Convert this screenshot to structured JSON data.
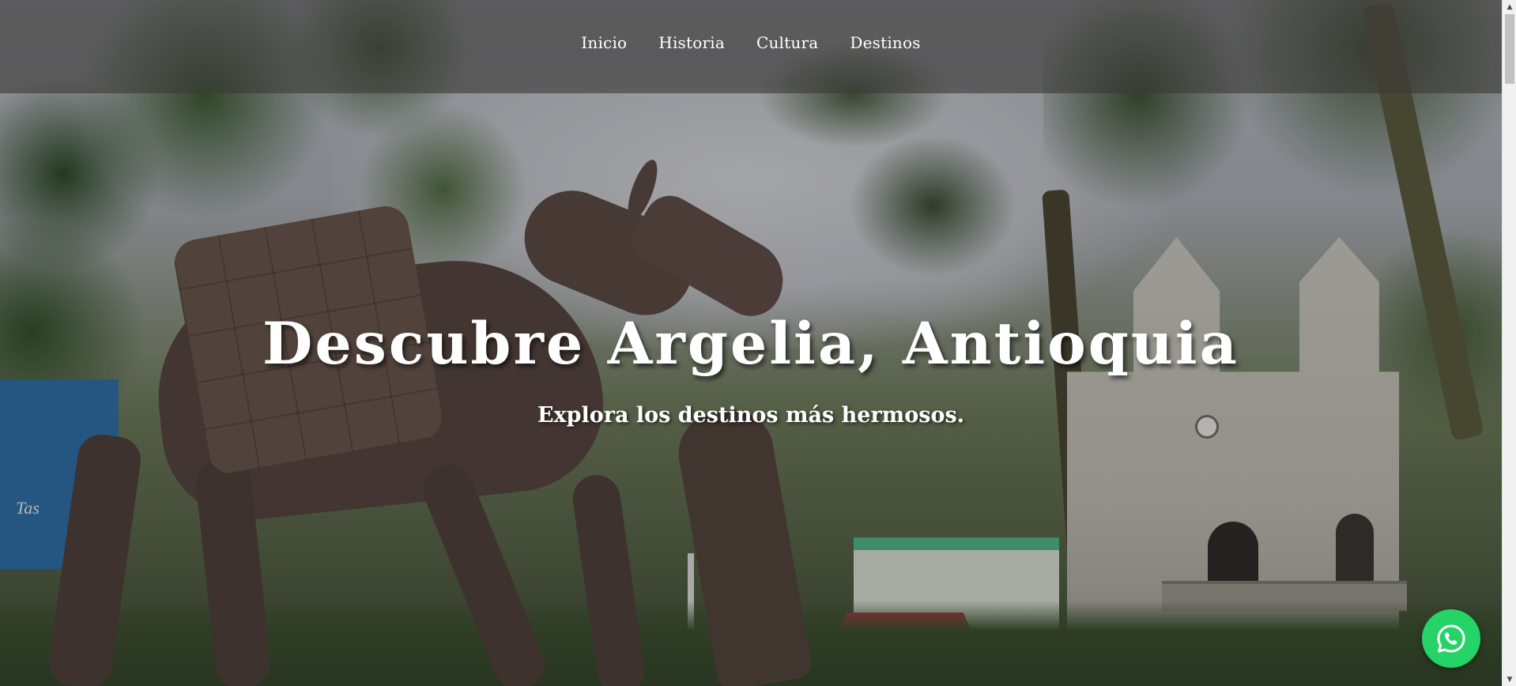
{
  "nav": {
    "items": [
      {
        "label": "Inicio"
      },
      {
        "label": "Historia"
      },
      {
        "label": "Cultura"
      },
      {
        "label": "Destinos"
      }
    ]
  },
  "hero": {
    "title": "Descubre Argelia, Antioquia",
    "subtitle": "Explora los destinos más hermosos.",
    "background_image": {
      "description": "Bronze mule sculpture in a town square with trees, palm fronds and a white Gothic church",
      "storefront_sign": "Tas"
    }
  },
  "whatsapp": {
    "icon": "whatsapp-icon",
    "color": "#25d366"
  },
  "colors": {
    "nav_background": "rgba(60,58,56,0.62)",
    "text": "#ffffff"
  }
}
